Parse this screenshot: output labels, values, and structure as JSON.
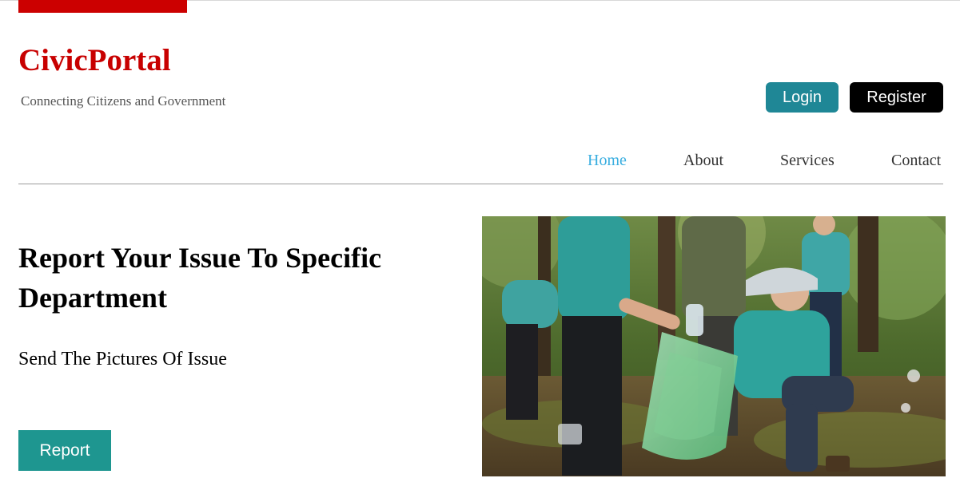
{
  "brand": {
    "name": "CivicPortal",
    "tagline": "Connecting Citizens and Government"
  },
  "auth": {
    "login_label": "Login",
    "register_label": "Register"
  },
  "nav": {
    "items": [
      {
        "label": "Home",
        "active": true
      },
      {
        "label": "About",
        "active": false
      },
      {
        "label": "Services",
        "active": false
      },
      {
        "label": "Contact",
        "active": false
      }
    ]
  },
  "hero": {
    "title": "Report Your Issue To Specific Department",
    "subtitle": "Send The Pictures Of Issue",
    "cta_label": "Report",
    "image_icon": "volunteers-cleanup-photo"
  },
  "colors": {
    "brand": "#c80000",
    "accent_bar": "#cc0000",
    "login_button": "#1f8796",
    "register_button": "#000000",
    "nav_active": "#3aaee0",
    "report_button": "#1e9690"
  }
}
